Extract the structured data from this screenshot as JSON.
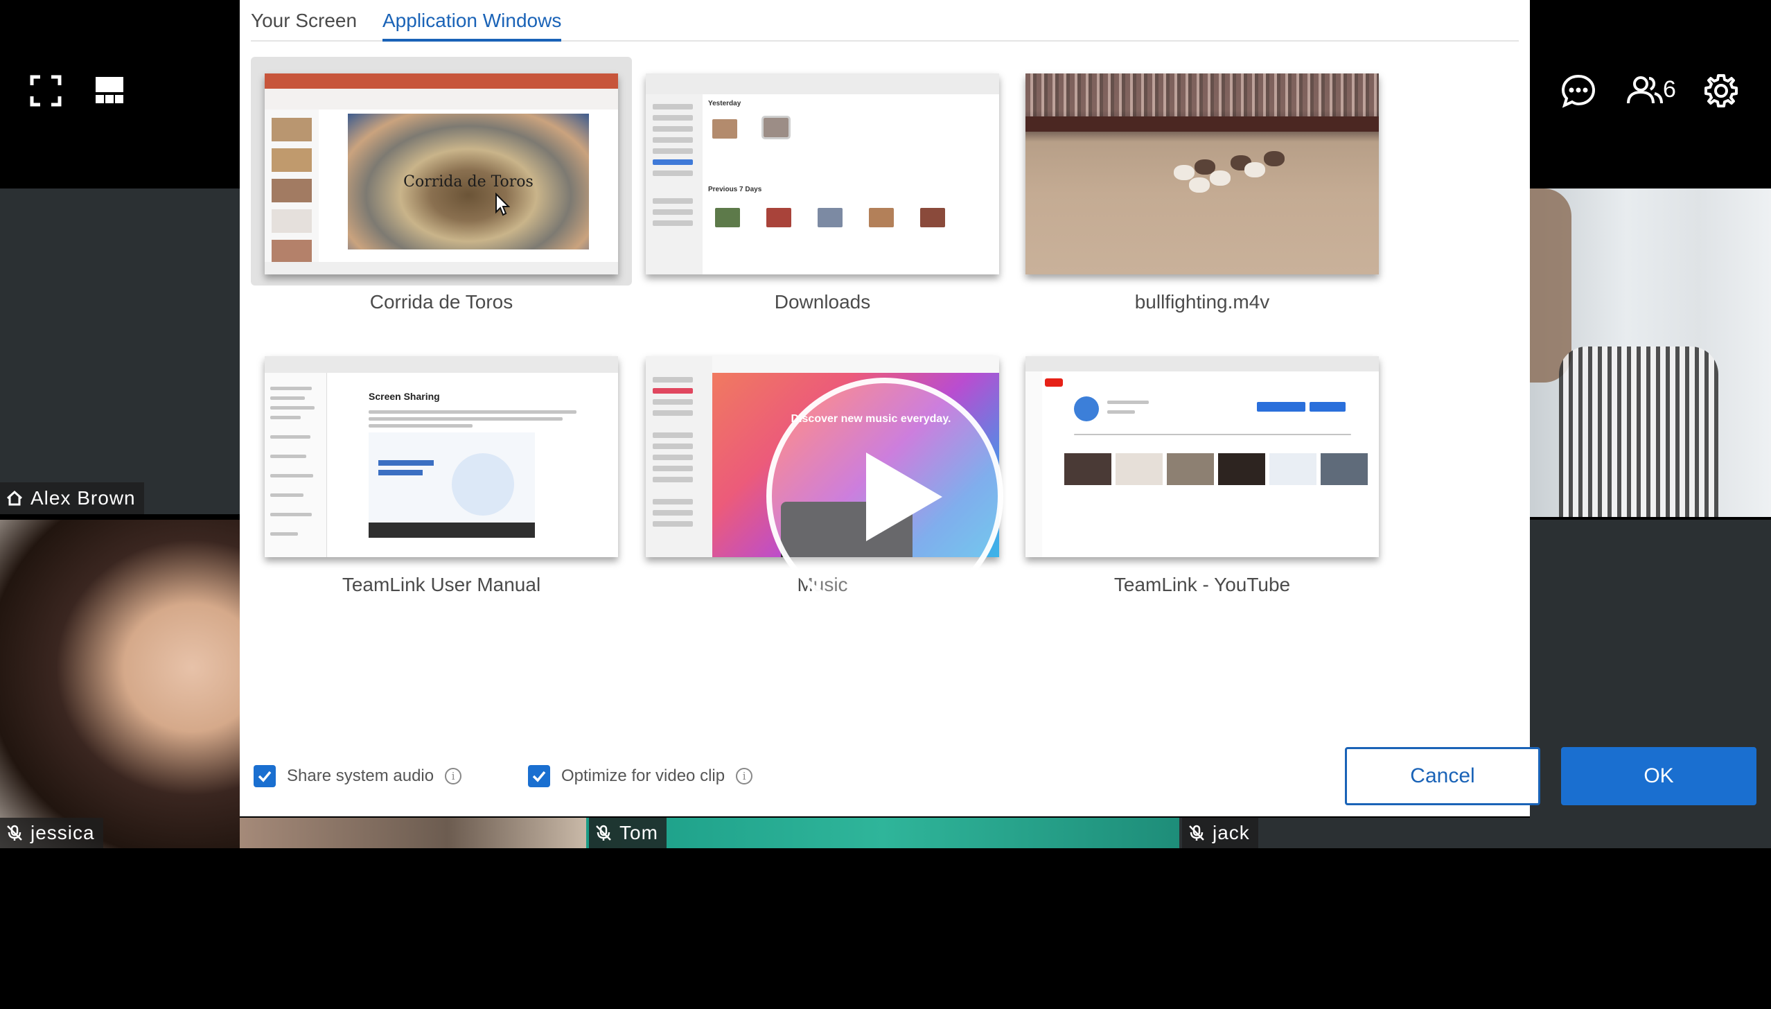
{
  "dialog": {
    "tabs": [
      {
        "label": "Your Screen",
        "active": false
      },
      {
        "label": "Application Windows",
        "active": true
      }
    ],
    "windows": [
      {
        "label": "Corrida de Toros",
        "selected": true
      },
      {
        "label": "Downloads",
        "selected": false
      },
      {
        "label": "bullfighting.m4v",
        "selected": false
      },
      {
        "label": "TeamLink User Manual",
        "selected": false
      },
      {
        "label": "Music",
        "selected": false
      },
      {
        "label": "TeamLink - YouTube",
        "selected": false
      }
    ],
    "options": {
      "share_audio": {
        "label": "Share system audio",
        "checked": true
      },
      "optimize_video": {
        "label": "Optimize for video clip",
        "checked": true
      }
    },
    "buttons": {
      "cancel": "Cancel",
      "ok": "OK"
    }
  },
  "thumbnails": {
    "ppt_slide_title": "Corrida de Toros",
    "finder_section_yesterday": "Yesterday",
    "finder_section_previous": "Previous 7 Days",
    "manual_heading": "Screen Sharing",
    "music_hero": "Discover new music everyday."
  },
  "toolbar": {
    "participants_count": "6",
    "icons": [
      "fullscreen-icon",
      "layout-icon",
      "chat-icon",
      "participants-icon",
      "settings-icon"
    ]
  },
  "participants": [
    {
      "name": "Alex Brown",
      "icon": "home-icon"
    },
    {
      "name": "jessica",
      "icon": "mic-muted-icon"
    },
    {
      "name": "Tom",
      "icon": "mic-muted-icon"
    },
    {
      "name": "jack",
      "icon": "mic-muted-icon"
    }
  ],
  "colors": {
    "accent": "#1a6fd0",
    "tab_active": "#1a63b7"
  }
}
